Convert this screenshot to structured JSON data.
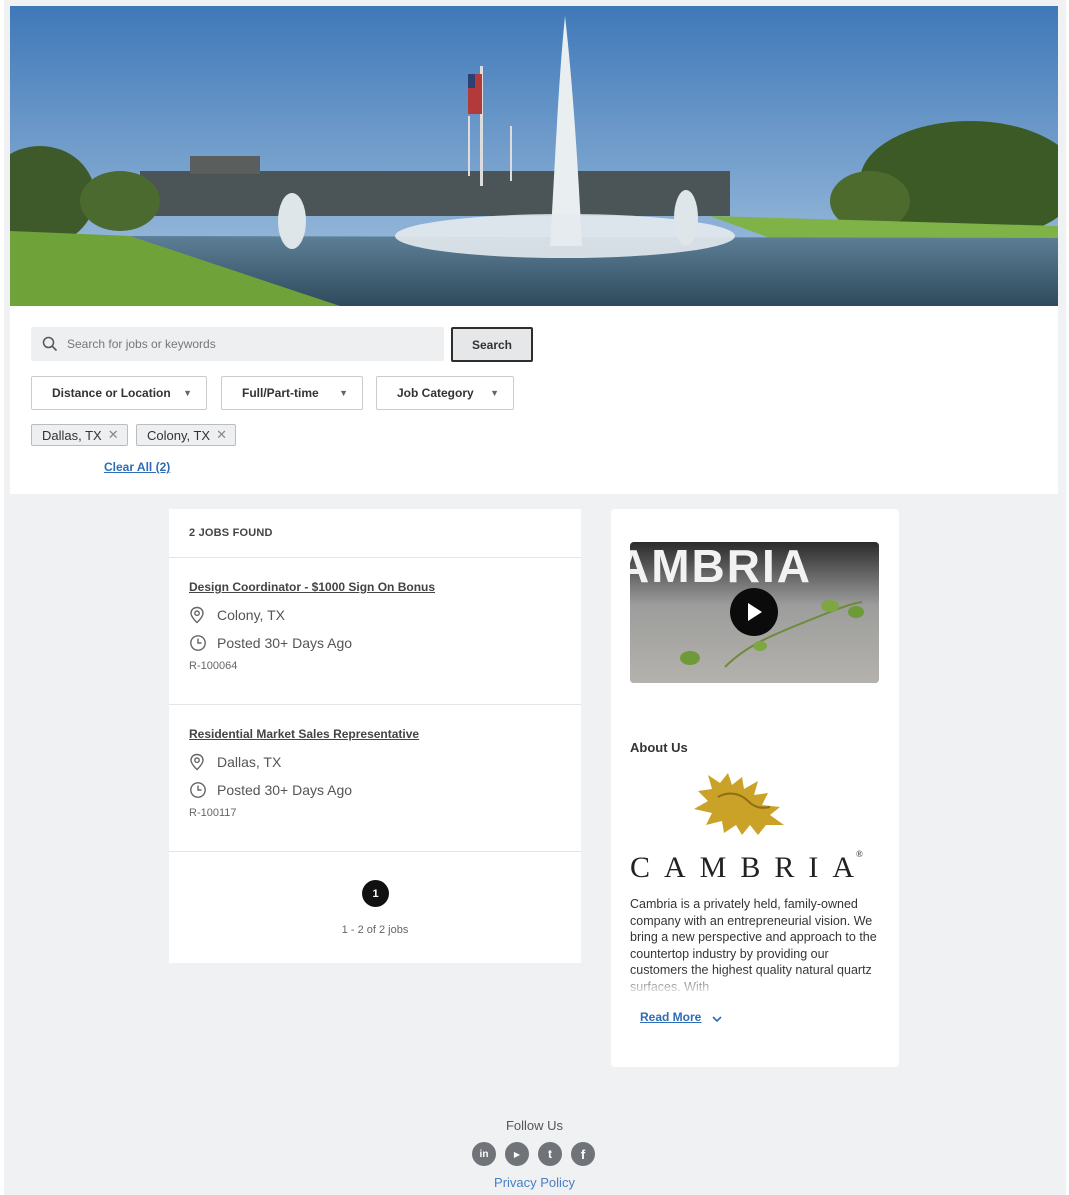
{
  "search": {
    "placeholder": "Search for jobs or keywords",
    "button_label": "Search"
  },
  "filters": {
    "distance_label": "Distance or Location",
    "type_label": "Full/Part-time",
    "category_label": "Job Category",
    "chips": [
      "Dallas, TX",
      "Colony, TX"
    ],
    "clear_all": "Clear All (2)"
  },
  "results": {
    "count_label": "2 JOBS FOUND",
    "jobs": [
      {
        "title": "Design Coordinator - $1000 Sign On Bonus",
        "location": "Colony, TX",
        "posted": "Posted 30+ Days Ago",
        "id": "R-100064"
      },
      {
        "title": "Residential Market Sales Representative",
        "location": "Dallas, TX",
        "posted": "Posted 30+ Days Ago",
        "id": "R-100117"
      }
    ],
    "page": "1",
    "range_label": "1 - 2 of 2 jobs"
  },
  "sidebar": {
    "video_text": "AMBRIA",
    "about_title": "About Us",
    "brand": "CAMBRIA",
    "brand_mark": "®",
    "about_text": "Cambria is a privately held, family-owned company with an entrepreneurial vision. We bring a new perspective and approach to the countertop industry by providing our customers the highest quality natural quartz surfaces. With",
    "read_more": "Read More"
  },
  "footer": {
    "follow_us": "Follow Us",
    "socials": [
      {
        "name": "linkedin",
        "glyph": "in"
      },
      {
        "name": "youtube",
        "glyph": "▶"
      },
      {
        "name": "twitter",
        "glyph": "t"
      },
      {
        "name": "facebook",
        "glyph": "f"
      }
    ],
    "privacy": "Privacy Policy"
  },
  "colors": {
    "accent_link": "#2e6db5",
    "page_bg": "#eff1f3",
    "brand_gold": "#c9a227"
  }
}
